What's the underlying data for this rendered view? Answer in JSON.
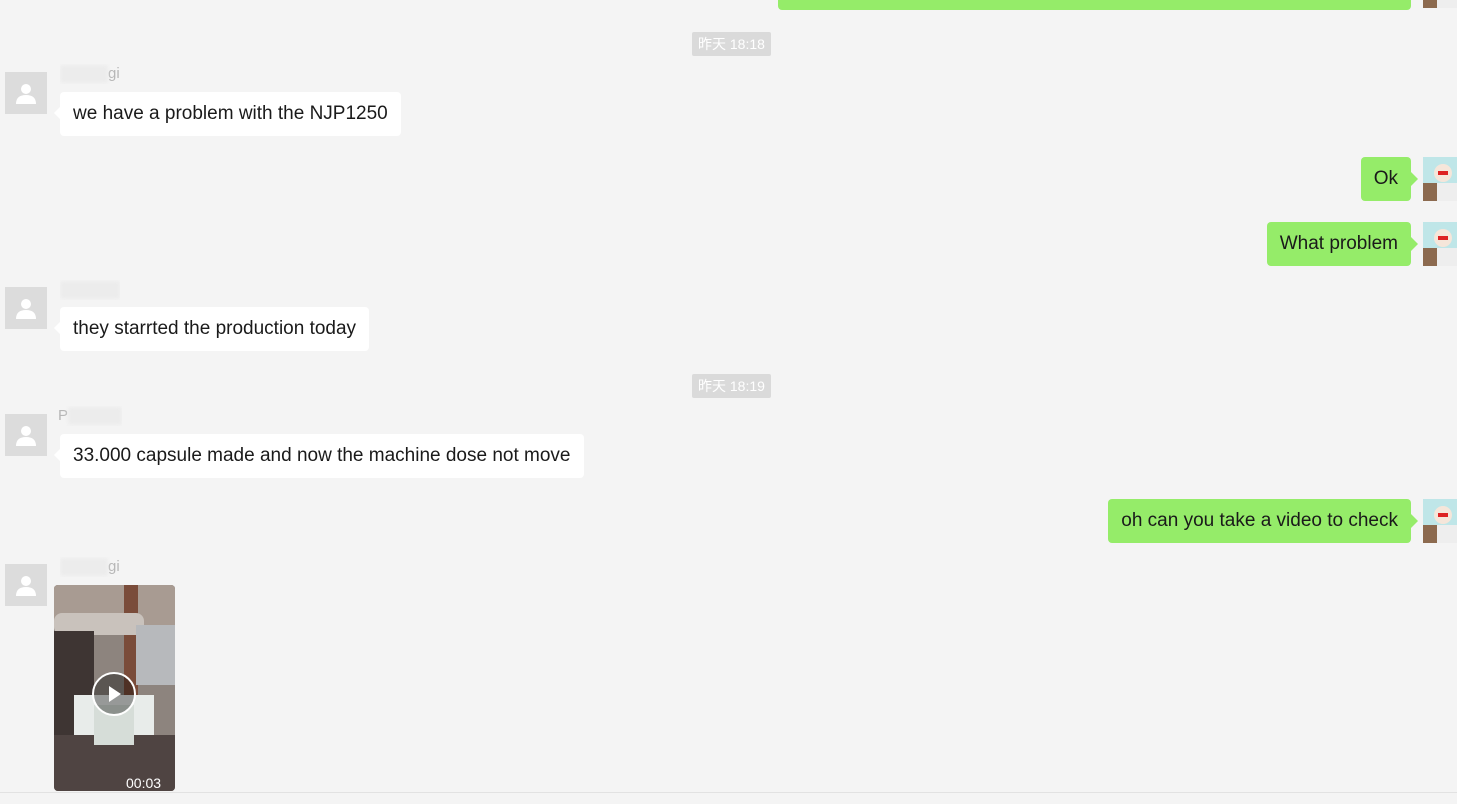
{
  "colors": {
    "background": "#f4f4f4",
    "incoming_bubble": "#ffffff",
    "outgoing_bubble": "#95ec69",
    "timestamp_bg": "#dadada"
  },
  "timestamps": [
    "昨天 18:18",
    "昨天 18:19"
  ],
  "messages": [
    {
      "direction": "out",
      "text": ""
    },
    {
      "direction": "in",
      "sender": "gi",
      "text": "we have a problem with the NJP1250"
    },
    {
      "direction": "out",
      "text": "Ok"
    },
    {
      "direction": "out",
      "text": "What problem"
    },
    {
      "direction": "in",
      "sender": "",
      "text": "they starrted the production today"
    },
    {
      "direction": "in",
      "sender": "P",
      "text": "33.000 capsule made and now the machine dose not move"
    },
    {
      "direction": "out",
      "text": "oh can you take a video to check"
    },
    {
      "direction": "in",
      "sender": "gi",
      "type": "video",
      "duration": "00:03",
      "icon": "play-icon"
    }
  ]
}
